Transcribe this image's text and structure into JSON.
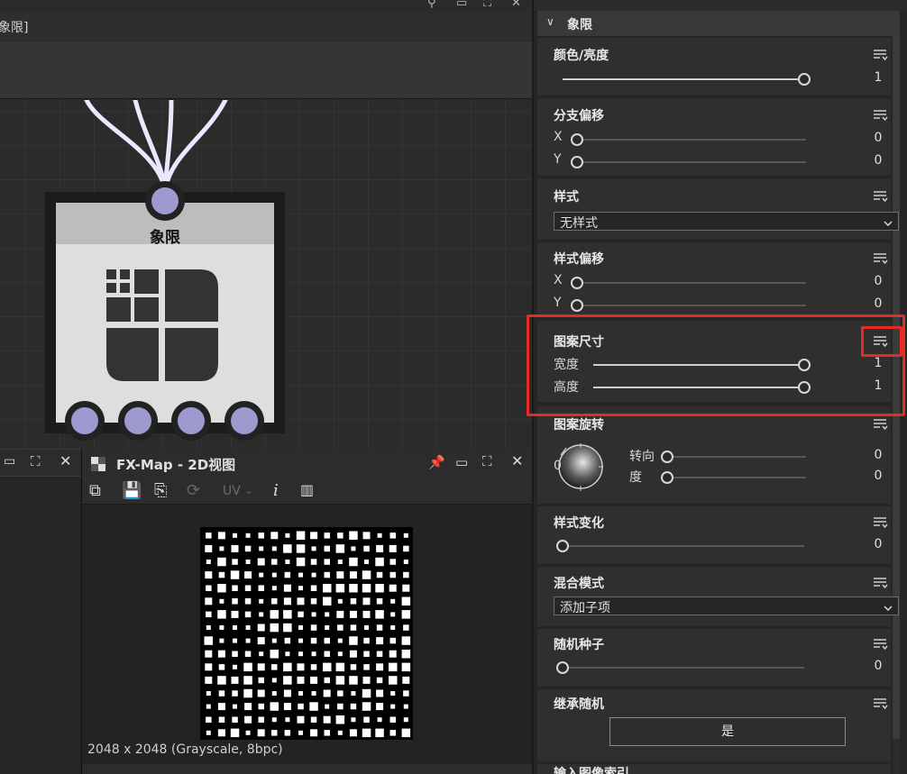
{
  "graph_panel": {
    "tab_label": "象限]",
    "node": {
      "title": "象限",
      "input_ports": 1,
      "output_ports": 4
    }
  },
  "view2d": {
    "title": "FX-Map - 2D视图",
    "toolbar": {
      "uv_label": "UV",
      "info_icon": "i"
    },
    "image_info": "2048 x 2048 (Grayscale, 8bpc)"
  },
  "properties": {
    "section_title": "象限",
    "groups": [
      {
        "title": "颜色/亮度",
        "sliders": [
          {
            "label": "",
            "value": "1",
            "fraction": 1.0
          }
        ]
      },
      {
        "title": "分支偏移",
        "sliders": [
          {
            "label": "X",
            "value": "0",
            "fraction": 0.0
          },
          {
            "label": "Y",
            "value": "0",
            "fraction": 0.0
          }
        ]
      },
      {
        "title": "样式",
        "dropdown": "无样式"
      },
      {
        "title": "样式偏移",
        "sliders": [
          {
            "label": "X",
            "value": "0",
            "fraction": 0.0
          },
          {
            "label": "Y",
            "value": "0",
            "fraction": 0.0
          }
        ]
      },
      {
        "title": "图案尺寸",
        "sliders": [
          {
            "label": "宽度",
            "value": "1",
            "fraction": 1.0
          },
          {
            "label": "高度",
            "value": "1",
            "fraction": 1.0
          }
        ]
      },
      {
        "title": "图案旋转",
        "dial_value": "0",
        "sliders": [
          {
            "label": "转向",
            "value": "0",
            "fraction": 0.0
          },
          {
            "label": "度",
            "value": "0",
            "fraction": 0.0
          }
        ]
      },
      {
        "title": "样式变化",
        "sliders": [
          {
            "label": "",
            "value": "0",
            "fraction": 0.0
          }
        ]
      },
      {
        "title": "混合模式",
        "dropdown": "添加子项"
      },
      {
        "title": "随机种子",
        "sliders": [
          {
            "label": "",
            "value": "0",
            "fraction": 0.0
          }
        ]
      },
      {
        "title": "继承随机",
        "button": "是"
      },
      {
        "title": "输入图像索引"
      }
    ]
  },
  "colors": {
    "highlight": "#e62b25",
    "port": "#9d9ad0",
    "wire": "#e8e8ff"
  }
}
